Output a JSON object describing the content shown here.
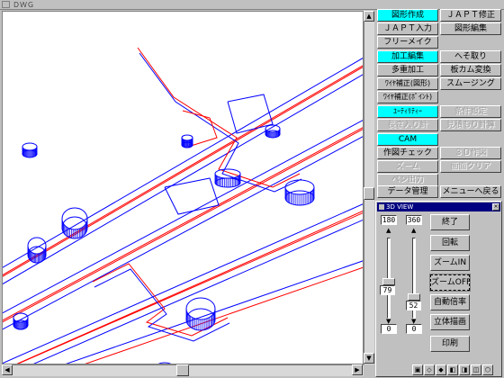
{
  "window": {
    "title": "ＤＷＧ"
  },
  "panel": {
    "buttons": [
      {
        "label": "図形作成",
        "state": "active"
      },
      {
        "label": "ＪＡＰＴ修正",
        "state": "normal"
      },
      {
        "label": "ＪＡＰＴ入力",
        "state": "normal"
      },
      {
        "label": "図形編集",
        "state": "normal"
      },
      {
        "label": "フリーメイク",
        "state": "normal"
      },
      {
        "label": "加工編集",
        "state": "active"
      },
      {
        "label": "へそ取り",
        "state": "normal"
      },
      {
        "label": "多重加工",
        "state": "normal"
      },
      {
        "label": "板カム変換",
        "state": "normal"
      },
      {
        "label": "ﾜｲﾔ補正(図形)",
        "state": "normal"
      },
      {
        "label": "スムージング",
        "state": "normal"
      },
      {
        "label": "ﾜｲﾔ補正(ﾎﾟｲﾝﾄ)",
        "state": "normal"
      },
      {
        "label": "ﾕｰﾃｨﾘﾃｨｰ",
        "state": "active"
      },
      {
        "label": "条件設定",
        "state": "disabled"
      },
      {
        "label": "長さ入り計",
        "state": "disabled"
      },
      {
        "label": "見積もり計算",
        "state": "disabled"
      },
      {
        "label": "CAM",
        "state": "active"
      },
      {
        "label": "作図チェック",
        "state": "normal"
      },
      {
        "label": "３Ｄ作図",
        "state": "disabled"
      },
      {
        "label": "ズーム",
        "state": "disabled"
      },
      {
        "label": "画面クリア",
        "state": "disabled"
      },
      {
        "label": "ペン出力",
        "state": "disabled"
      },
      {
        "label": "データ管理",
        "state": "normal"
      },
      {
        "label": "メニューへ戻る",
        "state": "normal"
      }
    ]
  },
  "view3d": {
    "title": "3D VIEW",
    "rot_top_left": "180",
    "rot_top_right": "360",
    "rot_bottom_left": "0",
    "rot_bottom_right": "0",
    "slider_left_value": "79",
    "slider_right_value": "52",
    "slider_left_level": 0.45,
    "slider_right_level": 0.25,
    "buttons": {
      "end": "終了",
      "rotate": "回転",
      "zoom_in": "ズームIN",
      "zoom_off": "ズームOFF",
      "auto_scale": "自動倍率",
      "stereo": "立体描画",
      "print": "印刷"
    },
    "toolbar_icons": [
      "hidden-line-icon",
      "wire-icon",
      "shade-icon",
      "side-view-icon",
      "front-view-icon",
      "top-view-icon",
      "iso-view-icon"
    ]
  },
  "colors": {
    "active": "#00ffff",
    "face": "#c0c0c0",
    "wire_red": "#ff0000",
    "wire_blue": "#0000ff",
    "title": "#000080"
  }
}
